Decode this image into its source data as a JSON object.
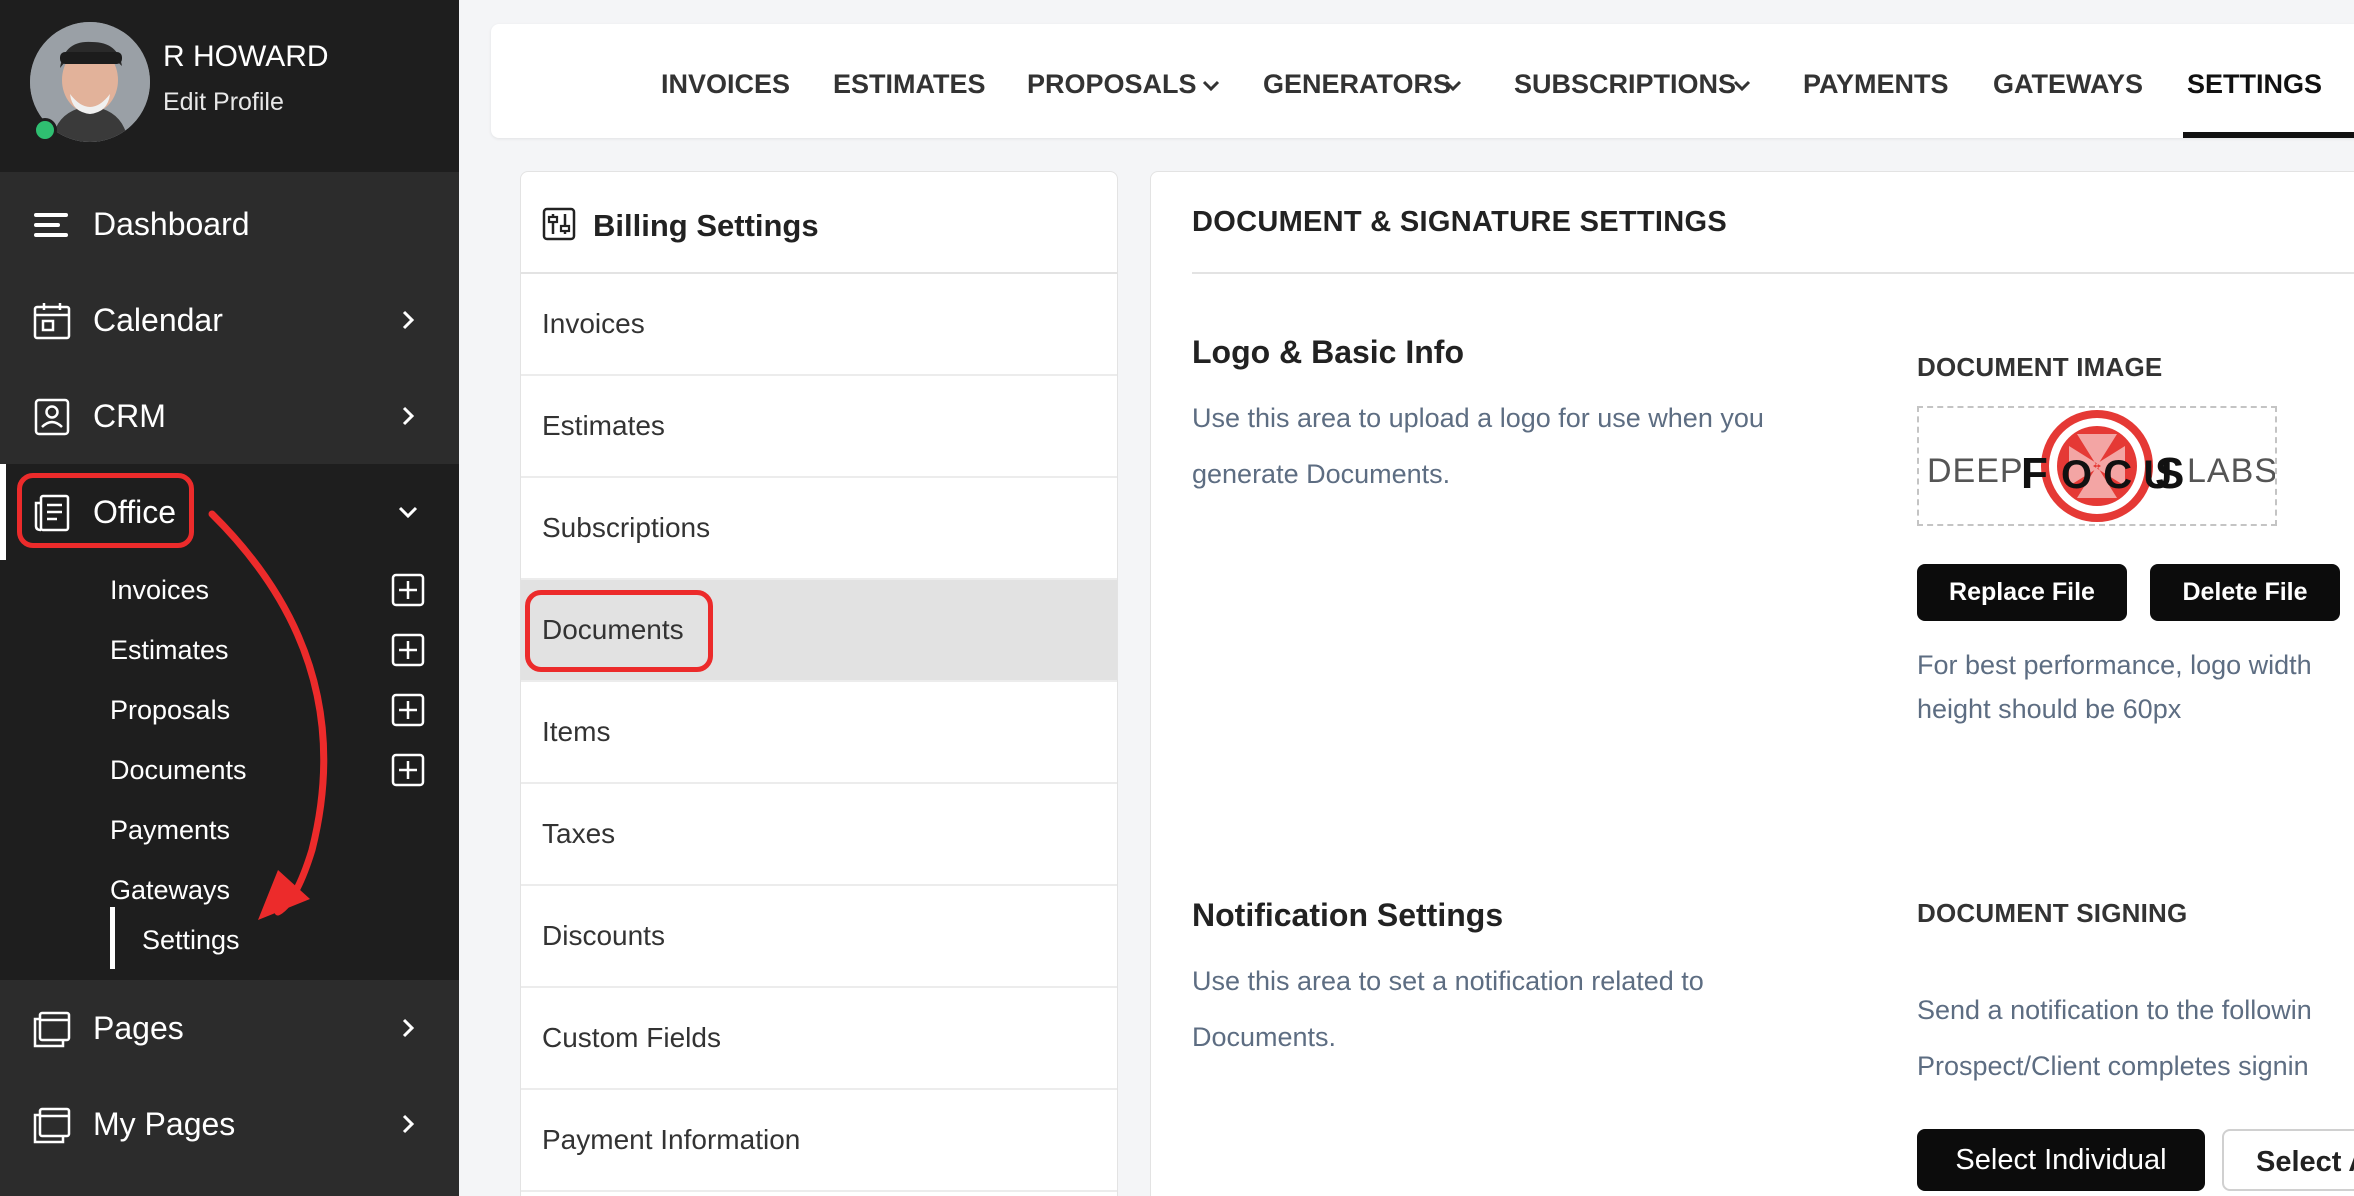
{
  "sidebar": {
    "profile": {
      "name": "R HOWARD",
      "edit_label": "Edit Profile"
    },
    "items": [
      {
        "label": "Dashboard",
        "icon": "menu-lines-icon"
      },
      {
        "label": "Calendar",
        "icon": "calendar-icon"
      },
      {
        "label": "CRM",
        "icon": "contact-card-icon"
      },
      {
        "label": "Office",
        "icon": "office-receipt-icon",
        "expanded": true
      },
      {
        "label": "Pages",
        "icon": "pages-icon"
      },
      {
        "label": "My Pages",
        "icon": "pages-icon"
      }
    ],
    "office_subitems": [
      {
        "label": "Invoices",
        "has_add": true
      },
      {
        "label": "Estimates",
        "has_add": true
      },
      {
        "label": "Proposals",
        "has_add": true
      },
      {
        "label": "Documents",
        "has_add": true
      },
      {
        "label": "Payments",
        "has_add": false
      },
      {
        "label": "Gateways",
        "has_add": false
      },
      {
        "label": "Settings",
        "has_add": false,
        "active": true
      }
    ]
  },
  "topnav": {
    "tabs": [
      {
        "label": "INVOICES",
        "dropdown": false
      },
      {
        "label": "ESTIMATES",
        "dropdown": false
      },
      {
        "label": "PROPOSALS",
        "dropdown": true
      },
      {
        "label": "GENERATORS",
        "dropdown": true
      },
      {
        "label": "SUBSCRIPTIONS",
        "dropdown": true
      },
      {
        "label": "PAYMENTS",
        "dropdown": false
      },
      {
        "label": "GATEWAYS",
        "dropdown": false
      },
      {
        "label": "SETTINGS",
        "dropdown": false,
        "active": true
      }
    ]
  },
  "billing": {
    "title": "Billing Settings",
    "items": [
      "Invoices",
      "Estimates",
      "Subscriptions",
      "Documents",
      "Items",
      "Taxes",
      "Discounts",
      "Custom Fields",
      "Payment Information"
    ],
    "selected": "Documents"
  },
  "document_settings": {
    "title": "DOCUMENT & SIGNATURE SETTINGS",
    "logo_section": {
      "title": "Logo & Basic Info",
      "description": "Use this area to upload a logo for use when you generate Documents.",
      "image_label": "DOCUMENT IMAGE",
      "logo_text_left": "DEEP",
      "logo_text_focus_left": "F",
      "logo_text_focus_mid": "O C U",
      "logo_text_focus_right": "S",
      "logo_text_right": "LABS",
      "replace_label": "Replace File",
      "delete_label": "Delete File",
      "hint_line1": "For best performance, logo width",
      "hint_line2": "height should be 60px"
    },
    "notification_section": {
      "title": "Notification Settings",
      "description": "Use this area to set a notification related to Documents.",
      "signing_label": "DOCUMENT SIGNING",
      "signing_line1": "Send a notification to the followin",
      "signing_line2": "Prospect/Client completes signin",
      "select_individual_label": "Select Individual",
      "select_other_label": "Select A"
    }
  },
  "colors": {
    "sidebar_bg": "#2c2c2c",
    "sidebar_dark": "#1e1e1e",
    "highlight_red": "#ec2b2b",
    "online_green": "#2fbf71",
    "logo_red": "#e53935"
  }
}
